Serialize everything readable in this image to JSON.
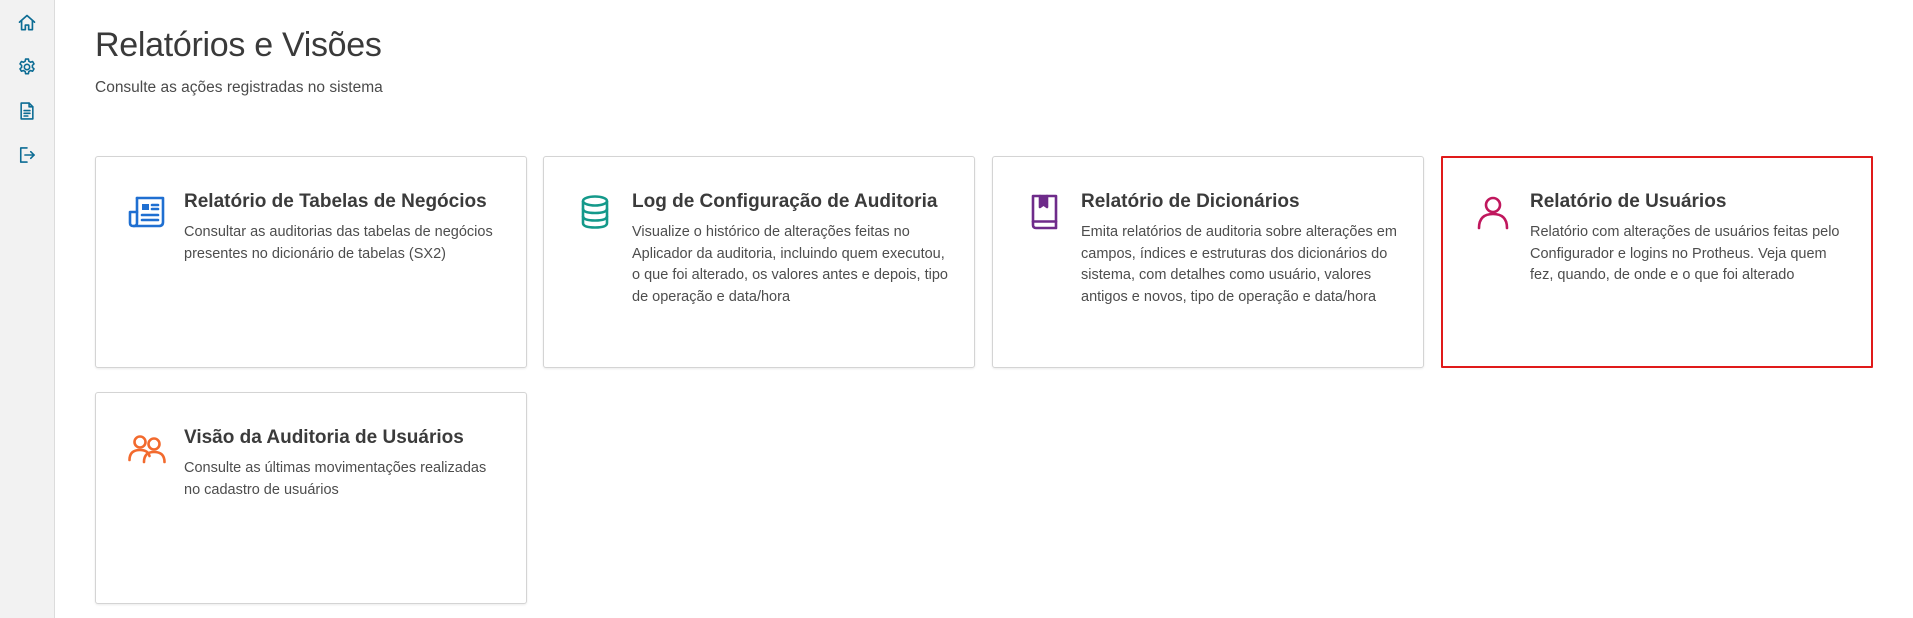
{
  "sidebar": {
    "items": [
      {
        "icon": "home-icon",
        "label": "Home"
      },
      {
        "icon": "gear-icon",
        "label": "Configurações"
      },
      {
        "icon": "document-icon",
        "label": "Relatórios"
      },
      {
        "icon": "logout-icon",
        "label": "Sair"
      }
    ],
    "icon_color": "#0c6c94"
  },
  "header": {
    "title": "Relatórios e Visões",
    "subtitle": "Consulte as ações registradas no sistema"
  },
  "cards": [
    {
      "title": "Relatório de Tabelas de Negócios",
      "description": "Consultar as auditorias das tabelas de negócios presentes no dicionário de tabelas (SX2)",
      "icon": "newspaper-icon",
      "icon_color": "#1f6fd1"
    },
    {
      "title": "Log de Configuração de Auditoria",
      "description": "Visualize o histórico de alterações feitas no Aplicador da auditoria, incluindo quem executou, o que foi alterado, os valores antes e depois, tipo de operação e data/hora",
      "icon": "database-icon",
      "icon_color": "#14998a"
    },
    {
      "title": "Relatório de Dicionários",
      "description": "Emita relatórios de auditoria sobre alterações em campos, índices e estruturas dos dicionários do sistema, com detalhes como usuário, valores antigos e novos, tipo de operação e data/hora",
      "icon": "book-icon",
      "icon_color": "#6e2b8a"
    },
    {
      "title": "Relatório de Usuários",
      "description": "Relatório com alterações de usuários feitas pelo Configurador e logins no Protheus. Veja quem fez, quando, de onde e o que foi alterado",
      "icon": "user-icon",
      "icon_color": "#c0175d",
      "highlighted": true,
      "highlight_color": "#e01a1a"
    },
    {
      "title": "Visão da Auditoria de Usuários",
      "description": "Consulte as últimas movimentações realizadas no cadastro de usuários",
      "icon": "users-icon",
      "icon_color": "#f26a2e"
    }
  ]
}
